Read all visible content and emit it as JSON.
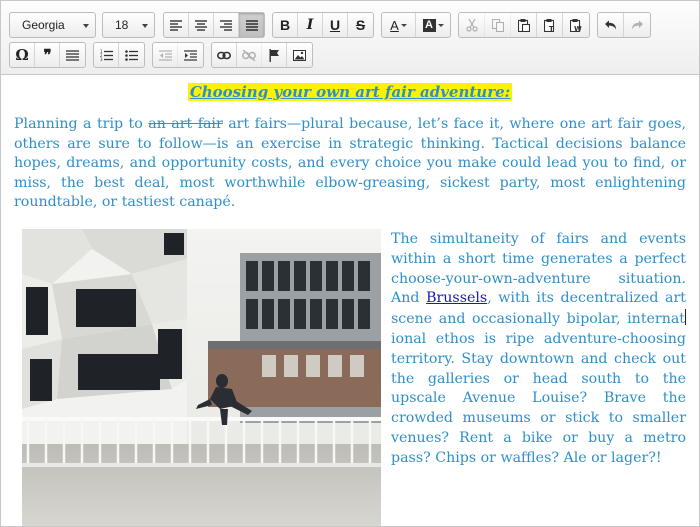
{
  "toolbar": {
    "font_family": "Georgia",
    "font_size": "18",
    "alignment": [
      "align-left",
      "align-center",
      "align-right",
      "justify"
    ],
    "active_alignment": "justify",
    "format_labels": {
      "bold": "B",
      "italic": "I",
      "underline": "U",
      "strikethrough": "S"
    },
    "text_color_label": "A",
    "background_color_label": "A",
    "clipboard": [
      "cut",
      "copy",
      "paste",
      "paste-as-text",
      "paste-from-word"
    ],
    "history": [
      "undo",
      "redo"
    ],
    "row2": {
      "special_char": "Ω",
      "blockquote": "99",
      "icons": [
        "horizontal-rule",
        "numbered-list",
        "bulleted-list",
        "decrease-indent",
        "increase-indent",
        "link",
        "unlink",
        "anchor",
        "image"
      ]
    }
  },
  "document": {
    "title": "Choosing your own art fair adventure:",
    "paragraph1": {
      "before": "Planning a trip to ",
      "strikethrough": "an art fair",
      "after": " art fairs—plural because, let’s face it, where one art fair goes, others are sure to follow—is an exercise in strategic thinking. Tactical decisions balance hopes, dreams, and opportunity costs, and every choice you make could lead you to find, or miss, the best deal, most worthwhile elbow-greasing, sickest party, most enlightening roundtable, or tastiest canapé."
    },
    "paragraph2": {
      "before_link": "The simultaneity of fairs and events within a short time generates a perfect choose-your-own-adventure situation. And ",
      "link_text": "Brussels",
      "after_link_1": ", with its decentralized art scene and occasionally bipolar, internat",
      "after_link_2": "ional ethos is ripe adventure-choosing territory. Stay downtown and check out the galleries or head south to the upscale Avenue Louise? Brave the crowded museums or stick to smaller venues? Rent a bike or buy a metro pass? Chips or waffles? Ale or lager?!"
    },
    "colors": {
      "text": "#2f8fc8",
      "title_highlight": "#fff200",
      "link": "#1a1ab0"
    }
  }
}
